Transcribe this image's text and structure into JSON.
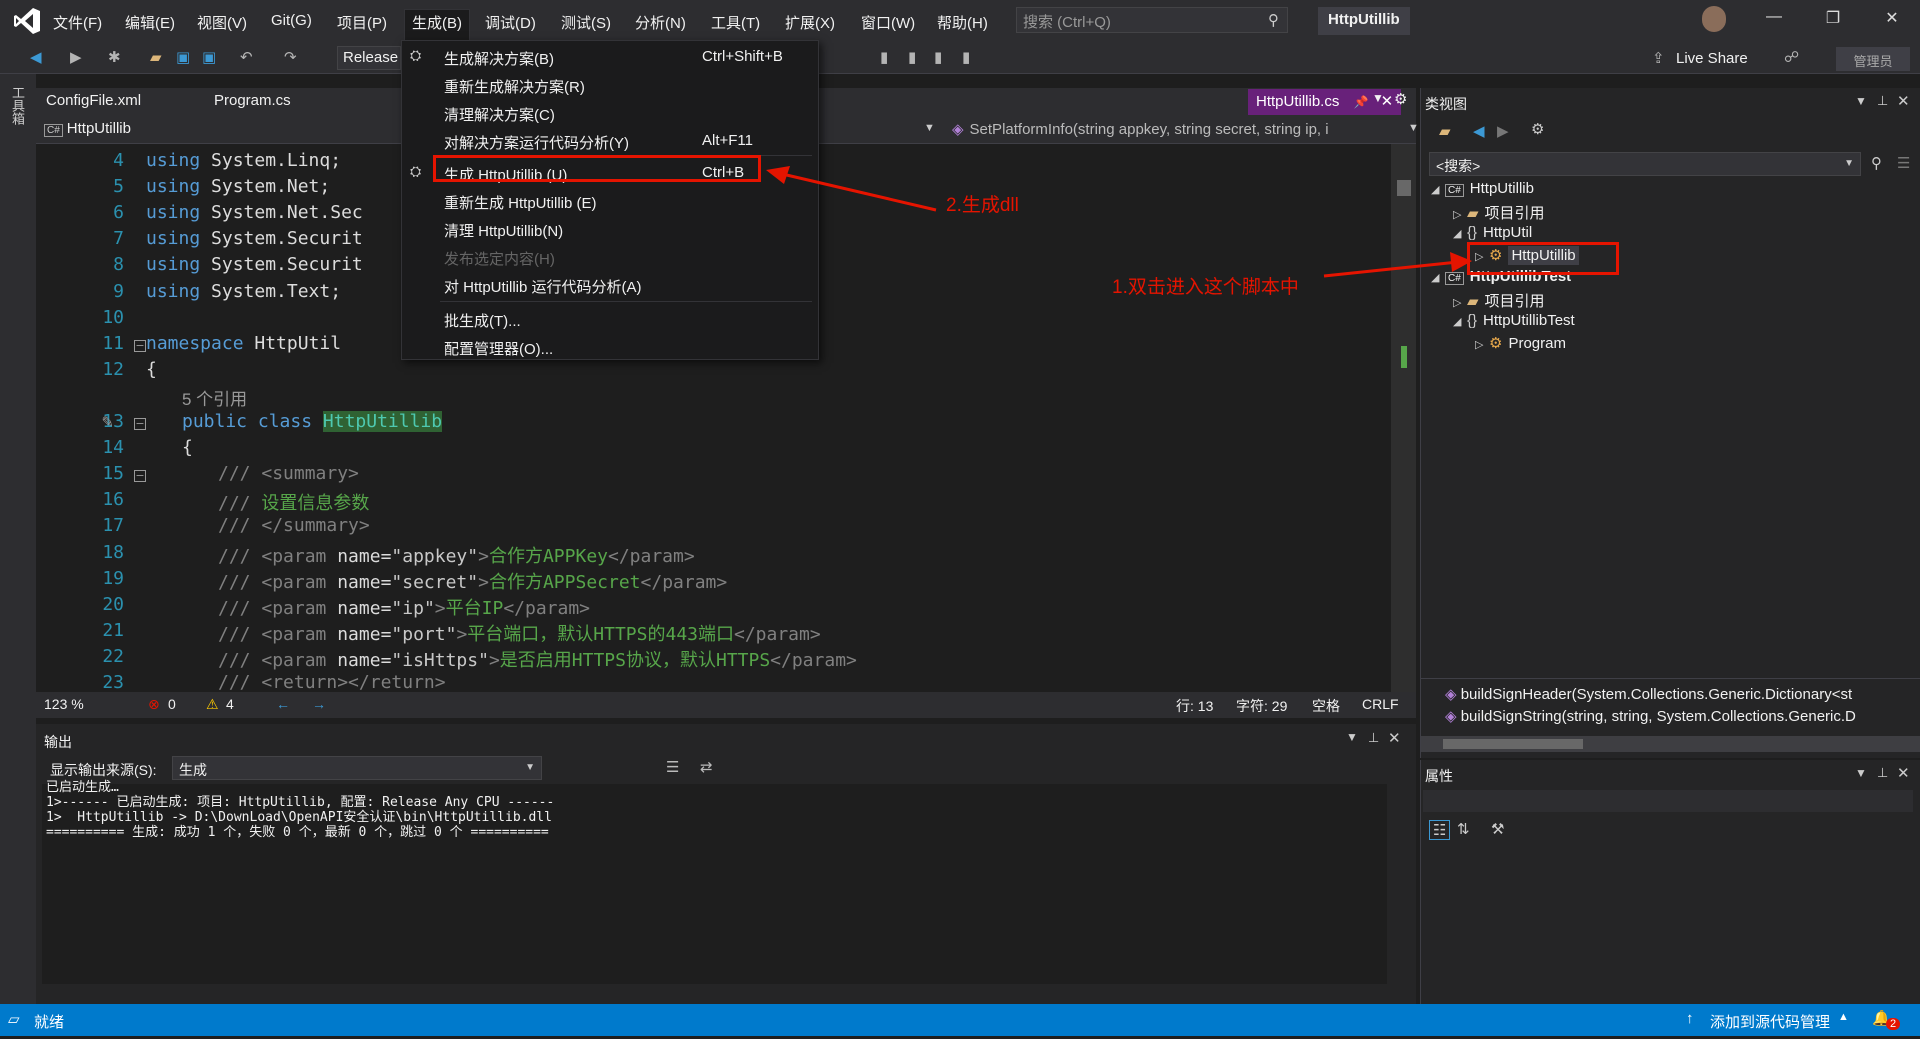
{
  "menubar": {
    "items": [
      "文件(F)",
      "编辑(E)",
      "视图(V)",
      "Git(G)",
      "项目(P)",
      "生成(B)",
      "调试(D)",
      "测试(S)",
      "分析(N)",
      "工具(T)",
      "扩展(X)",
      "窗口(W)",
      "帮助(H)"
    ],
    "search_placeholder": "搜索 (Ctrl+Q)",
    "solution_name": "HttpUtillib"
  },
  "toolbar": {
    "configuration": "Release",
    "live_share": "Live Share",
    "admin": "管理员"
  },
  "left_strip": {
    "label": "工具箱"
  },
  "editor": {
    "tabs": [
      "ConfigFile.xml",
      "Program.cs"
    ],
    "active_tab": "HttpUtillib.cs",
    "nav_project": "HttpUtillib",
    "nav_member": "SetPlatformInfo(string appkey, string secret, string ip, i",
    "lines": [
      {
        "n": "4",
        "kw": "using",
        "rest": " System.Linq;"
      },
      {
        "n": "5",
        "kw": "using",
        "rest": " System.Net;"
      },
      {
        "n": "6",
        "kw": "using",
        "rest": " System.Net.Sec"
      },
      {
        "n": "7",
        "kw": "using",
        "rest": " System.Securit"
      },
      {
        "n": "8",
        "kw": "using",
        "rest": " System.Securit"
      },
      {
        "n": "9",
        "kw": "using",
        "rest": " System.Text;"
      },
      {
        "n": "10"
      },
      {
        "n": "11",
        "kw": "namespace",
        "rest": " HttpUtil"
      },
      {
        "n": "12",
        "rest": "{"
      },
      {
        "n": "",
        "refs": "5 个引用"
      },
      {
        "n": "13",
        "kw": "public class",
        "class_name": "HttpUtillib"
      },
      {
        "n": "14",
        "rest": "{"
      },
      {
        "n": "15",
        "xmlp": "/// ",
        "xml": "<summary>"
      },
      {
        "n": "16",
        "xmlp": "/// ",
        "cm": "设置信息参数"
      },
      {
        "n": "17",
        "xmlp": "/// ",
        "xml": "</summary>"
      },
      {
        "n": "18",
        "param_name": "appkey",
        "param_desc": "合作方APPKey"
      },
      {
        "n": "19",
        "param_name": "secret",
        "param_desc": "合作方APPSecret"
      },
      {
        "n": "20",
        "param_name": "ip",
        "param_desc": "平台IP"
      },
      {
        "n": "21",
        "param_name": "port",
        "param_desc": "平台端口，默认HTTPS的443端口"
      },
      {
        "n": "22",
        "param_name": "isHttps",
        "param_desc": "是否启用HTTPS协议，默认HTTPS"
      },
      {
        "n": "23",
        "xmlp": "/// ",
        "xml": "<return></return>"
      }
    ],
    "xml_param_open": "<param ",
    "xml_name_attr": "name=",
    "xml_param_close": "</param>",
    "status": {
      "zoom": "123 %",
      "errors": "0",
      "warnings": "4",
      "line": "行: 13",
      "char": "字符: 29",
      "spacing": "空格",
      "eol": "CRLF"
    }
  },
  "output": {
    "title": "输出",
    "source_label": "显示输出来源(S):",
    "source_value": "生成",
    "lines": [
      "已启动生成…",
      "1>------ 已启动生成: 项目: HttpUtillib, 配置: Release Any CPU ------",
      "1>  HttpUtillib -> D:\\DownLoad\\OpenAPI安全认证\\bin\\HttpUtillib.dll",
      "========== 生成: 成功 1 个，失败 0 个，最新 0 个，跳过 0 个 =========="
    ]
  },
  "classview": {
    "title": "类视图",
    "search_placeholder": "<搜索>",
    "tree": [
      {
        "label": "HttpUtillib",
        "arrow": "◢",
        "icon": "C#",
        "indent": 0
      },
      {
        "label": "项目引用",
        "arrow": "▷",
        "icon": "folder",
        "indent": 1
      },
      {
        "label": "HttpUtil",
        "arrow": "◢",
        "icon": "{}",
        "indent": 1
      },
      {
        "label": "HttpUtillib",
        "arrow": "▷",
        "icon": "class",
        "indent": 2
      },
      {
        "label": "HttpUtillibTest",
        "arrow": "◢",
        "icon": "C#",
        "indent": 0
      },
      {
        "label": "项目引用",
        "arrow": "▷",
        "icon": "folder",
        "indent": 1
      },
      {
        "label": "HttpUtillibTest",
        "arrow": "◢",
        "icon": "{}",
        "indent": 1
      },
      {
        "label": "Program",
        "arrow": "▷",
        "icon": "class",
        "indent": 2
      }
    ],
    "members": [
      "buildSignHeader(System.Collections.Generic.Dictionary<st",
      "buildSignString(string, string, System.Collections.Generic.D"
    ]
  },
  "properties": {
    "title": "属性"
  },
  "statusbar": {
    "ready": "就绪",
    "source_control": "添加到源代码管理",
    "notifications": "2"
  },
  "build_menu": {
    "items": [
      {
        "label": "生成解决方案(B)",
        "shortcut": "Ctrl+Shift+B",
        "icon": "build-icon"
      },
      {
        "label": "重新生成解决方案(R)",
        "shortcut": ""
      },
      {
        "label": "清理解决方案(C)",
        "shortcut": ""
      },
      {
        "label": "对解决方案运行代码分析(Y)",
        "shortcut": "Alt+F11"
      },
      {
        "label": "生成 HttpUtillib (U)",
        "shortcut": "Ctrl+B",
        "icon": "build-icon"
      },
      {
        "label": "重新生成 HttpUtillib (E)",
        "shortcut": ""
      },
      {
        "label": "清理 HttpUtillib(N)",
        "shortcut": ""
      },
      {
        "label": "发布选定内容(H)",
        "shortcut": "",
        "disabled": true
      },
      {
        "label": "对 HttpUtillib 运行代码分析(A)",
        "shortcut": ""
      },
      {
        "label": "批生成(T)...",
        "shortcut": ""
      },
      {
        "label": "配置管理器(O)...",
        "shortcut": ""
      }
    ]
  },
  "annotations": {
    "step1": "1.双击进入这个脚本中",
    "step2": "2.生成dll",
    "color": "#e51400"
  }
}
